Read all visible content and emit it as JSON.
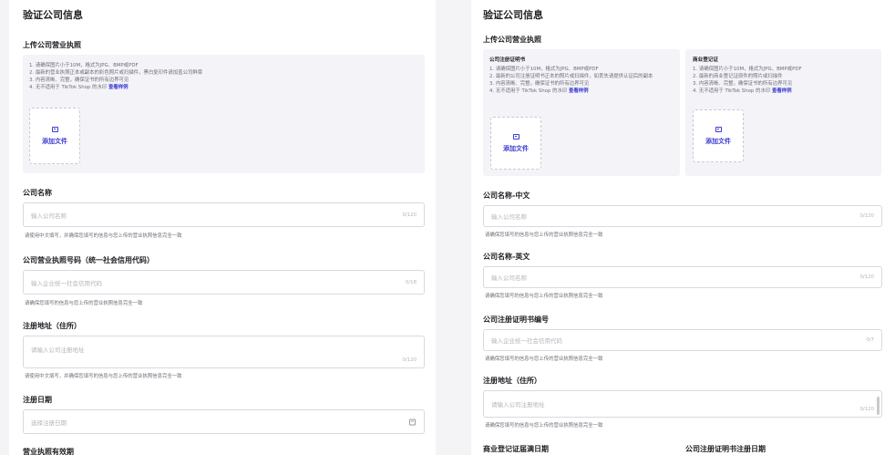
{
  "left": {
    "title": "验证公司信息",
    "upload_section": "上传公司营业执照",
    "notes": [
      "1. 请确保图片小于10M，格式为JPG、BMP或PDF",
      "2. 最新的营业执照正本或副本的彩色照片或扫描件，黑白复印件请加盖公司鲜章",
      "3. 内容清晰、完整，确保证书的所有边界可见",
      "4. 无不适用于 TikTok Shop 的水印"
    ],
    "example_link": "查看样例",
    "add_file": "添加文件",
    "company_name": {
      "label": "公司名称",
      "placeholder": "输入公司名称",
      "counter": "0/120",
      "hint": "请使用中文填写，并确保您填写的信息与您上传的营业执照信息完全一致"
    },
    "license_no": {
      "label": "公司营业执照号码（统一社会信用代码）",
      "placeholder": "输入企业统一社会信用代码",
      "counter": "0/18",
      "hint": "请确保您填写的信息与您上传的营业执照信息完全一致"
    },
    "address": {
      "label": "注册地址（住所）",
      "placeholder": "请输入公司注册地址",
      "counter": "0/120",
      "hint": "请使用中文填写，并确保您填写的信息与您上传的营业执照信息完全一致"
    },
    "reg_date": {
      "label": "注册日期",
      "placeholder": "选择注册日期"
    },
    "validity_label": "营业执照有效期"
  },
  "right": {
    "title": "验证公司信息",
    "upload_section": "上传公司营业执照",
    "doc1": {
      "title": "公司注册证明书",
      "notes": [
        "1. 请确保图片小于10M，格式为JPG、BMP或PDF",
        "2. 最新的公司注册证明书正本的照片或扫描件，如丢失请提供认证后的副本",
        "3. 内容清晰、完整，确保证书的所有边界可见",
        "4. 无不适用于 TikTok Shop 的水印"
      ],
      "example_link": "查看样例",
      "add_file": "添加文件"
    },
    "doc2": {
      "title": "商业登记证",
      "notes": [
        "1. 请确保图片小于10M，格式为JPG、BMP或PDF",
        "2. 最新的商业登记证原件的照片或扫描件",
        "3. 内容清晰、完整，确保证书的所有边界可见",
        "4. 无不适用于 TikTok Shop 的水印"
      ],
      "example_link": "查看样例",
      "add_file": "添加文件"
    },
    "name_cn": {
      "label": "公司名称-中文",
      "placeholder": "输入公司名称",
      "counter": "0/120",
      "hint": "请确保您填写的信息与您上传的营业执照信息完全一致"
    },
    "name_en": {
      "label": "公司名称-英文",
      "placeholder": "输入公司名称",
      "counter": "0/120",
      "hint": "请确保您填写的信息与您上传的营业执照信息完全一致"
    },
    "cert_no": {
      "label": "公司注册证明书编号",
      "placeholder": "输入企业统一社会信用代码",
      "counter": "0/7",
      "hint": "请确保您填写的信息与您上传的营业执照信息完全一致"
    },
    "address": {
      "label": "注册地址（住所）",
      "placeholder": "请输入公司注册地址",
      "counter": "0/120",
      "hint": "请确保您填写的信息与您上传的营业执照信息完全一致"
    },
    "br_expiry_label": "商业登记证届满日期",
    "cert_reg_date_label": "公司注册证明书注册日期"
  }
}
